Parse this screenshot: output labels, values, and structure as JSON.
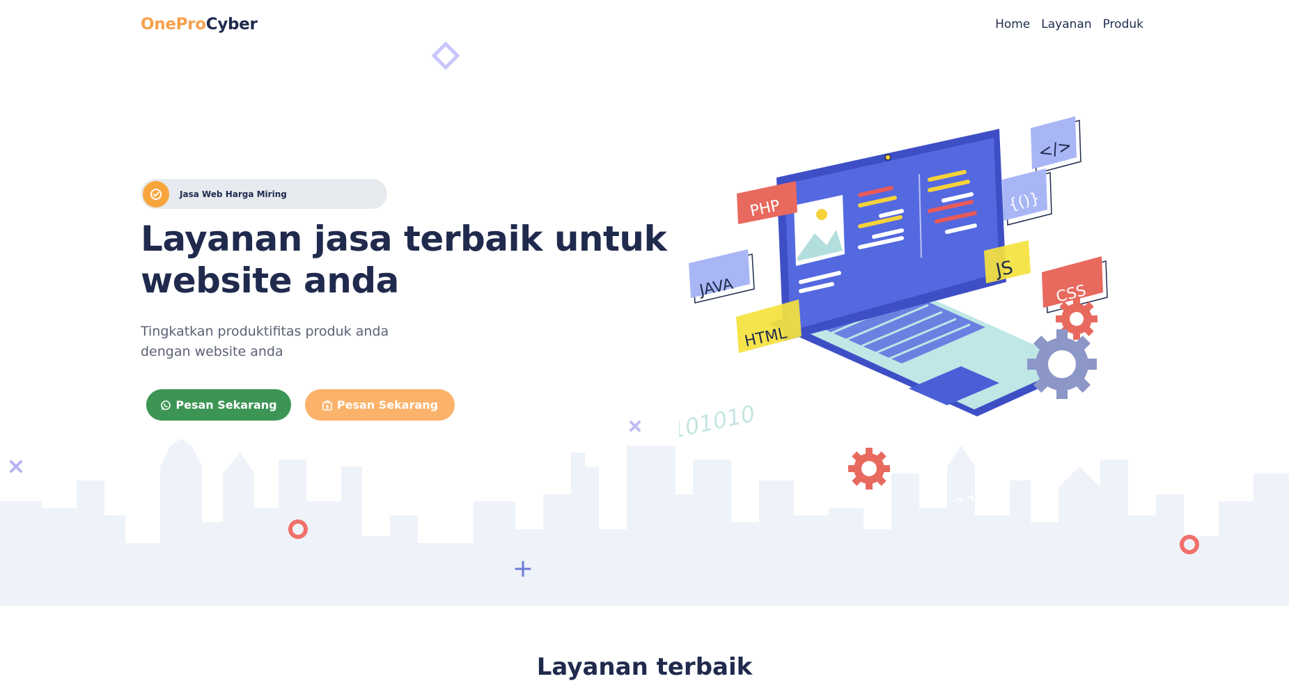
{
  "header": {
    "logo_part1": "OnePro",
    "logo_part2": "Cyber",
    "nav": [
      {
        "label": "Home"
      },
      {
        "label": "Layanan"
      },
      {
        "label": "Produk"
      }
    ]
  },
  "hero": {
    "badge_text": "Jasa Web Harga Miring",
    "title": "Layanan jasa terbaik untuk website anda",
    "subtitle": "Tingkatkan produktifitas produk anda dengan website anda",
    "primary_button": "Pesan Sekarang",
    "secondary_button": "Pesan Sekarang"
  },
  "illustration": {
    "tags": {
      "php": "PHP",
      "java": "JAVA",
      "html": "HTML",
      "js": "JS",
      "css": "CSS",
      "code": "</>",
      "braces": "{()}"
    },
    "binary": "0101010",
    "binary_short": "010"
  },
  "next_section": {
    "title": "Layanan terbaik"
  },
  "colors": {
    "brand_orange": "#f5a14b",
    "brand_dark": "#1f2a4d",
    "whatsapp_green": "#3c9555",
    "order_orange": "#fbb26a",
    "laptop_blue": "#4a5ed6"
  }
}
